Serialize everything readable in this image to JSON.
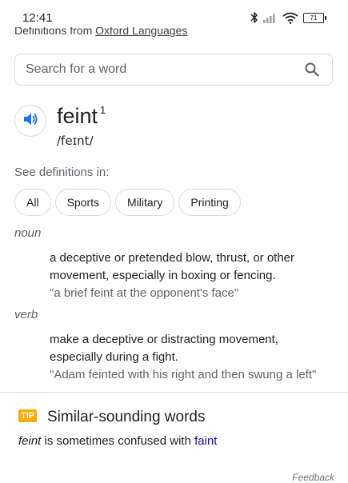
{
  "status_bar": {
    "time": "12:41",
    "battery": "71"
  },
  "source": {
    "prefix": "Definitions from ",
    "link": "Oxford Languages"
  },
  "search": {
    "placeholder": "Search for a word"
  },
  "entry": {
    "word": "feint",
    "superscript": "1",
    "phonetic": "/feɪnt/"
  },
  "see_definitions": {
    "label": "See definitions in:",
    "chips": [
      "All",
      "Sports",
      "Military",
      "Printing"
    ]
  },
  "senses": [
    {
      "pos": "noun",
      "definition": "a deceptive or pretended blow, thrust, or other movement, especially in boxing or fencing.",
      "example": "\"a brief feint at the opponent's face\""
    },
    {
      "pos": "verb",
      "definition": "make a deceptive or distracting movement, especially during a fight.",
      "example": "\"Adam feinted with his right and then swung a left\""
    }
  ],
  "tip": {
    "badge": "TIP",
    "title": "Similar-sounding words",
    "word": "feint",
    "middle": " is sometimes confused with ",
    "link": "faint"
  },
  "feedback": "Feedback",
  "colors": {
    "accent": "#1a73e8",
    "tip_badge": "#f9ab00",
    "link": "#1a0dab"
  },
  "icons": {
    "status": [
      "bluetooth-icon",
      "cell-signal-icon",
      "wifi-icon",
      "battery-icon"
    ],
    "search": "search-icon",
    "speaker": "speaker-icon"
  }
}
